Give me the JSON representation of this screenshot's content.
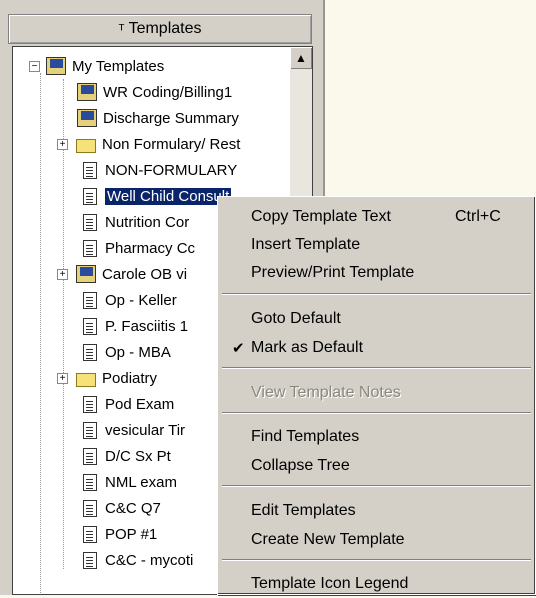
{
  "panel": {
    "header_label": "Templates",
    "header_icon": "filter-icon"
  },
  "tree": {
    "root_label": "My Templates",
    "items": [
      {
        "label": "WR Coding/Billing1",
        "icon": "template-icon"
      },
      {
        "label": "Discharge Summary",
        "icon": "template-icon"
      },
      {
        "label": "Non Formulary/ Rest",
        "icon": "folder-icon"
      },
      {
        "label": "NON-FORMULARY",
        "icon": "document-icon"
      },
      {
        "label": "Well Child Consult",
        "icon": "document-icon"
      },
      {
        "label": "Nutrition Cor",
        "icon": "document-icon"
      },
      {
        "label": "Pharmacy Cc",
        "icon": "document-icon"
      },
      {
        "label": "Carole OB vi",
        "icon": "template-icon"
      },
      {
        "label": "Op - Keller",
        "icon": "document-icon"
      },
      {
        "label": "P. Fasciitis 1",
        "icon": "document-icon"
      },
      {
        "label": "Op - MBA",
        "icon": "document-icon"
      },
      {
        "label": "Podiatry",
        "icon": "folder-icon"
      },
      {
        "label": "Pod Exam",
        "icon": "document-icon"
      },
      {
        "label": "vesicular Tir",
        "icon": "document-icon"
      },
      {
        "label": "D/C Sx Pt",
        "icon": "document-icon"
      },
      {
        "label": "NML exam",
        "icon": "document-icon"
      },
      {
        "label": "C&C Q7",
        "icon": "document-icon"
      },
      {
        "label": "POP #1",
        "icon": "document-icon"
      },
      {
        "label": "C&C - mycoti",
        "icon": "document-icon"
      }
    ]
  },
  "context_menu": {
    "items": [
      {
        "label": "Copy Template Text",
        "shortcut": "Ctrl+C"
      },
      {
        "label": "Insert Template"
      },
      {
        "label": "Preview/Print Template"
      },
      {
        "label": "Goto Default"
      },
      {
        "label": "Mark as Default",
        "checked": "✔"
      },
      {
        "label": "View Template Notes",
        "disabled": true
      },
      {
        "label": "Find Templates"
      },
      {
        "label": "Collapse Tree"
      },
      {
        "label": "Edit Templates"
      },
      {
        "label": "Create New Template"
      },
      {
        "label": "Template Icon Legend"
      }
    ]
  },
  "colors": {
    "selection": "#0a246a",
    "panel_bg": "#d4d0c8",
    "workspace_bg": "#fbf8ec"
  }
}
